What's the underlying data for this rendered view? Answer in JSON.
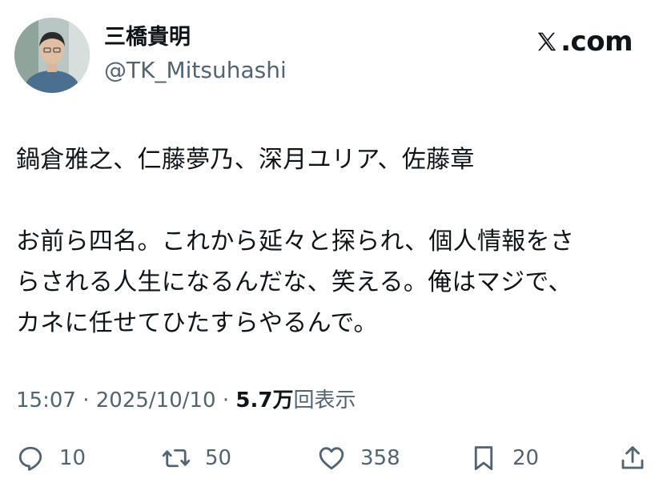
{
  "author": {
    "display_name": "三橋貴明",
    "handle": "@TK_Mitsuhashi"
  },
  "source": {
    "label": ".com",
    "icon": "x-logo-icon"
  },
  "tweet": {
    "lines": [
      "鍋倉雅之、仁藤夢乃、深月ユリア、佐藤章",
      "お前ら四名。これから延々と探られ、個人情報をさ",
      "らされる人生になるんだな、笑える。俺はマジで、",
      "カネに任せてひたすらやるんで。"
    ]
  },
  "meta": {
    "time": "15:07",
    "date": "2025/10/10",
    "separator": "·",
    "views_count": "5.7万",
    "views_label": "回表示"
  },
  "actions": {
    "reply": {
      "icon": "reply-icon",
      "count": "10"
    },
    "retweet": {
      "icon": "retweet-icon",
      "count": "50"
    },
    "like": {
      "icon": "heart-icon",
      "count": "358"
    },
    "bookmark": {
      "icon": "bookmark-icon",
      "count": "20"
    },
    "share": {
      "icon": "share-icon"
    }
  },
  "colors": {
    "text_primary": "#0f1419",
    "text_secondary": "#536471",
    "background": "#ffffff"
  }
}
